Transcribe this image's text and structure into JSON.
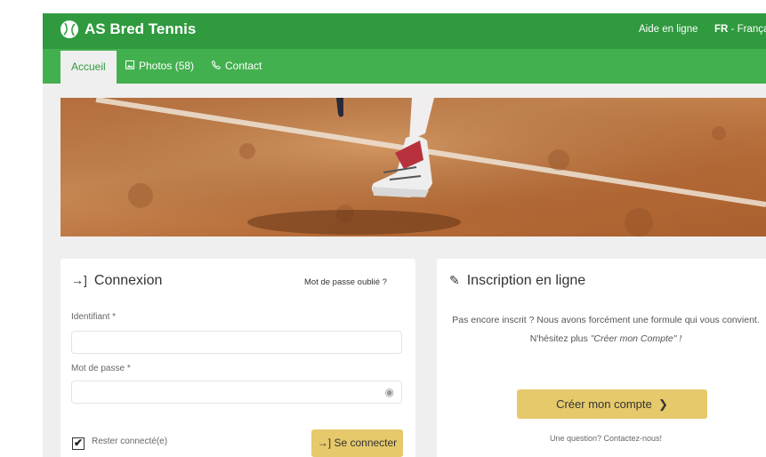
{
  "header": {
    "brand": "AS Bred Tennis",
    "help_link": "Aide en ligne",
    "lang_code": "FR",
    "lang_name": " - Français"
  },
  "nav": {
    "tabs": [
      {
        "label": "Accueil",
        "icon": ""
      },
      {
        "label": "Photos (58)",
        "icon": "image-icon"
      },
      {
        "label": "Contact",
        "icon": "phone-icon"
      }
    ]
  },
  "login": {
    "title": "Connexion",
    "forgot": "Mot de passe oublié ?",
    "username_label": "Identifiant *",
    "username_value": "",
    "password_label": "Mot de passe *",
    "password_value": "",
    "remember_label": "Rester connecté(e)",
    "remember_checked": true,
    "submit": "Se connecter"
  },
  "register": {
    "title": "Inscription en ligne",
    "text_line1": "Pas encore inscrit ? Nous avons forcément une formule qui vous convient.",
    "text_line2_prefix": "N'hésitez plus ",
    "text_line2_em": "\"Créer mon Compte\" !",
    "button": "Créer mon compte",
    "question": "Une question? Contactez-nous!"
  },
  "colors": {
    "header_green": "#2f9a3e",
    "nav_green": "#43b04f",
    "button_gold": "#e6c96b",
    "page_bg": "#efefef"
  }
}
